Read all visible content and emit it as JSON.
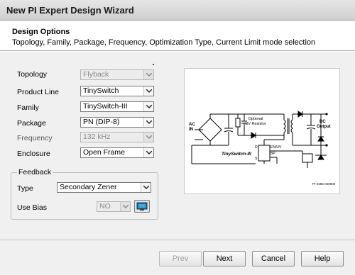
{
  "window": {
    "title": "New PI Expert Design Wizard"
  },
  "header": {
    "section_title": "Design Options",
    "subtitle": "Topology, Family, Package, Frequency, Optimization Type, Current Limit mode selection"
  },
  "form": {
    "topology": {
      "label": "Topology",
      "value": "Flyback",
      "enabled": false
    },
    "product_line": {
      "label": "Product Line",
      "value": "TinySwitch",
      "enabled": true
    },
    "family": {
      "label": "Family",
      "value": "TinySwitch-III",
      "enabled": true
    },
    "package": {
      "label": "Package",
      "value": "PN (DIP-8)",
      "enabled": true
    },
    "frequency": {
      "label": "Frequency",
      "value": "132 kHz",
      "enabled": false
    },
    "enclosure": {
      "label": "Enclosure",
      "value": "Open Frame",
      "enabled": true
    }
  },
  "feedback": {
    "legend": "Feedback",
    "type": {
      "label": "Type",
      "value": "Secondary Zener"
    },
    "use_bias": {
      "label": "Use Bias",
      "value": "NO",
      "enabled": false
    }
  },
  "schematic": {
    "ac_in": "AC\nIN",
    "optional_label": "Optional",
    "uv_resistor_label": "UV Resistor",
    "dc_output": "DC\nOutput",
    "ic_name": "TinySwitch-III",
    "pin_en": "EN/UV",
    "pin_bp": "BP",
    "pin_d": "D",
    "pin_s": "S",
    "ref_code": "PI-4355-040606"
  },
  "buttons": {
    "prev": "Prev",
    "next": "Next",
    "cancel": "Cancel",
    "help": "Help"
  },
  "icons": {
    "dropdown": "chevron-down-icon",
    "bias_settings": "monitor-icon"
  },
  "colors": {
    "title_bg": "#d9d9d9",
    "panel_bg": "#f0f0f0",
    "disabled_text": "#8a8a8a"
  }
}
